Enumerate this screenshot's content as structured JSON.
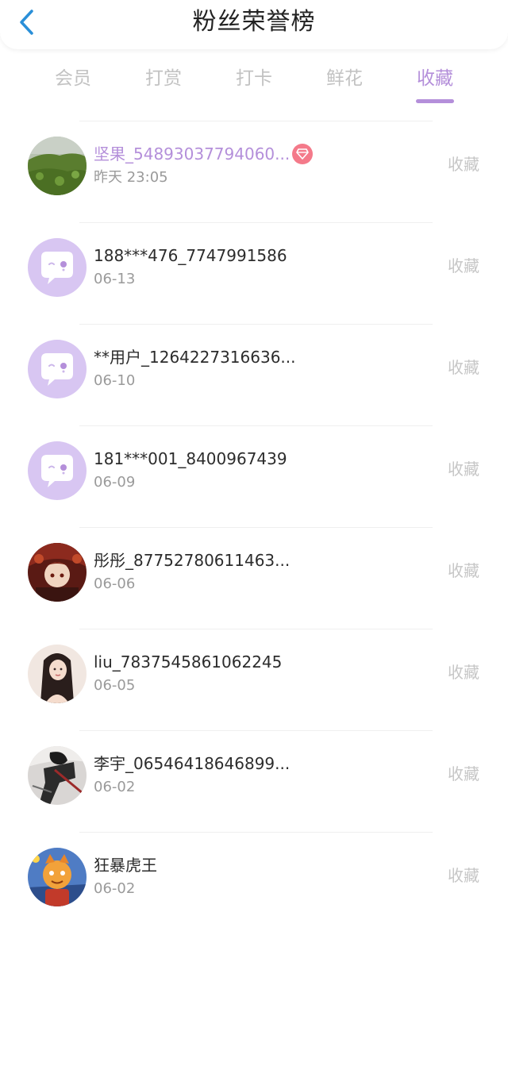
{
  "header": {
    "title": "粉丝荣誉榜",
    "back_icon": "chevron-left-icon"
  },
  "colors": {
    "accent": "#b48fda",
    "badge": "#f47a8a",
    "back_arrow": "#2a8fd8"
  },
  "tabs": [
    {
      "label": "会员",
      "active": false
    },
    {
      "label": "打赏",
      "active": false
    },
    {
      "label": "打卡",
      "active": false
    },
    {
      "label": "鲜花",
      "active": false
    },
    {
      "label": "收藏",
      "active": true
    }
  ],
  "fans": [
    {
      "name": "坚果_54893037794060...",
      "date": "昨天 23:05",
      "action": "收藏",
      "vip": true,
      "avatar": "landscape-photo"
    },
    {
      "name": "188***476_7747991586",
      "date": "06-13",
      "action": "收藏",
      "vip": false,
      "avatar": "default-chat-avatar"
    },
    {
      "name": "**用户_1264227316636...",
      "date": "06-10",
      "action": "收藏",
      "vip": false,
      "avatar": "default-chat-avatar"
    },
    {
      "name": "181***001_8400967439",
      "date": "06-09",
      "action": "收藏",
      "vip": false,
      "avatar": "default-chat-avatar"
    },
    {
      "name": "彤彤_87752780611463...",
      "date": "06-06",
      "action": "收藏",
      "vip": false,
      "avatar": "anime-character-photo"
    },
    {
      "name": "liu_7837545861062245",
      "date": "06-05",
      "action": "收藏",
      "vip": false,
      "avatar": "portrait-photo"
    },
    {
      "name": "李宇_06546418646899...",
      "date": "06-02",
      "action": "收藏",
      "vip": false,
      "avatar": "dark-figure-photo"
    },
    {
      "name": "狂暴虎王",
      "date": "06-02",
      "action": "收藏",
      "vip": false,
      "avatar": "game-character-photo"
    }
  ]
}
